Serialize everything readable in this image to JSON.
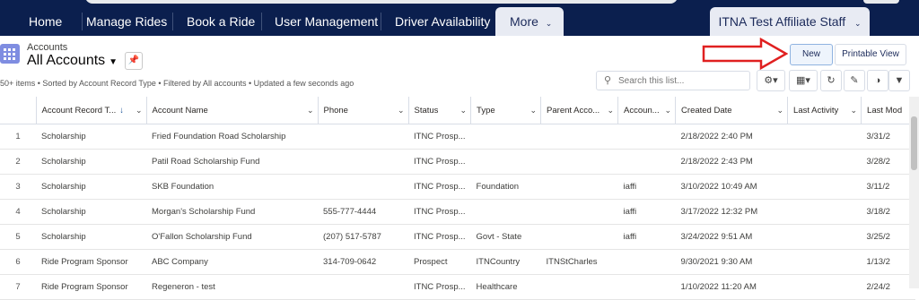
{
  "nav": {
    "tabs": [
      "Home",
      "Manage Rides",
      "Book a Ride",
      "User Management",
      "Driver Availability"
    ],
    "more_label": "More",
    "affiliate_label": "ITNA Test Affiliate Staff"
  },
  "header": {
    "breadcrumb": "Accounts",
    "title": "All Accounts",
    "meta": "50+ items • Sorted by Account Record Type • Filtered by All accounts • Updated a few seconds ago",
    "new_label": "New",
    "printable_label": "Printable View"
  },
  "search": {
    "placeholder": "Search this list..."
  },
  "table": {
    "columns": [
      "Account Record T...",
      "Account Name",
      "Phone",
      "Status",
      "Type",
      "Parent Acco...",
      "Accoun...",
      "Created Date",
      "Last Activity",
      "Last Mod"
    ],
    "rows": [
      {
        "n": "1",
        "rt": "Scholarship",
        "name": "Fried Foundation Road Scholarship",
        "phone": "",
        "status": "ITNC Prosp...",
        "type": "",
        "parent": "",
        "acct": "",
        "created": "2/18/2022 2:40 PM",
        "activity": "",
        "mod": "3/31/2"
      },
      {
        "n": "2",
        "rt": "Scholarship",
        "name": "Patil Road Scholarship Fund",
        "phone": "",
        "status": "ITNC Prosp...",
        "type": "",
        "parent": "",
        "acct": "",
        "created": "2/18/2022 2:43 PM",
        "activity": "",
        "mod": "3/28/2"
      },
      {
        "n": "3",
        "rt": "Scholarship",
        "name": "SKB Foundation",
        "phone": "",
        "status": "ITNC Prosp...",
        "type": "Foundation",
        "parent": "",
        "acct": "iaffi",
        "created": "3/10/2022 10:49 AM",
        "activity": "",
        "mod": "3/11/2"
      },
      {
        "n": "4",
        "rt": "Scholarship",
        "name": "Morgan's Scholarship Fund",
        "phone": "555-777-4444",
        "status": "ITNC Prosp...",
        "type": "",
        "parent": "",
        "acct": "iaffi",
        "created": "3/17/2022 12:32 PM",
        "activity": "",
        "mod": "3/18/2"
      },
      {
        "n": "5",
        "rt": "Scholarship",
        "name": "O'Fallon Scholarship Fund",
        "phone": "(207) 517-5787",
        "status": "ITNC Prosp...",
        "type": "Govt - State",
        "parent": "",
        "acct": "iaffi",
        "created": "3/24/2022 9:51 AM",
        "activity": "",
        "mod": "3/25/2"
      },
      {
        "n": "6",
        "rt": "Ride Program Sponsor",
        "name": "ABC Company",
        "phone": "314-709-0642",
        "status": "Prospect",
        "type": "ITNCountry",
        "parent": "ITNStCharles",
        "acct": "",
        "created": "9/30/2021 9:30 AM",
        "activity": "",
        "mod": "1/13/2"
      },
      {
        "n": "7",
        "rt": "Ride Program Sponsor",
        "name": "Regeneron - test",
        "phone": "",
        "status": "ITNC Prosp...",
        "type": "Healthcare",
        "parent": "",
        "acct": "",
        "created": "1/10/2022 11:20 AM",
        "activity": "",
        "mod": "2/24/2"
      }
    ]
  },
  "colors": {
    "nav_bg": "#0b1f4e",
    "accent": "#1b5297",
    "arrow": "#e02020"
  }
}
